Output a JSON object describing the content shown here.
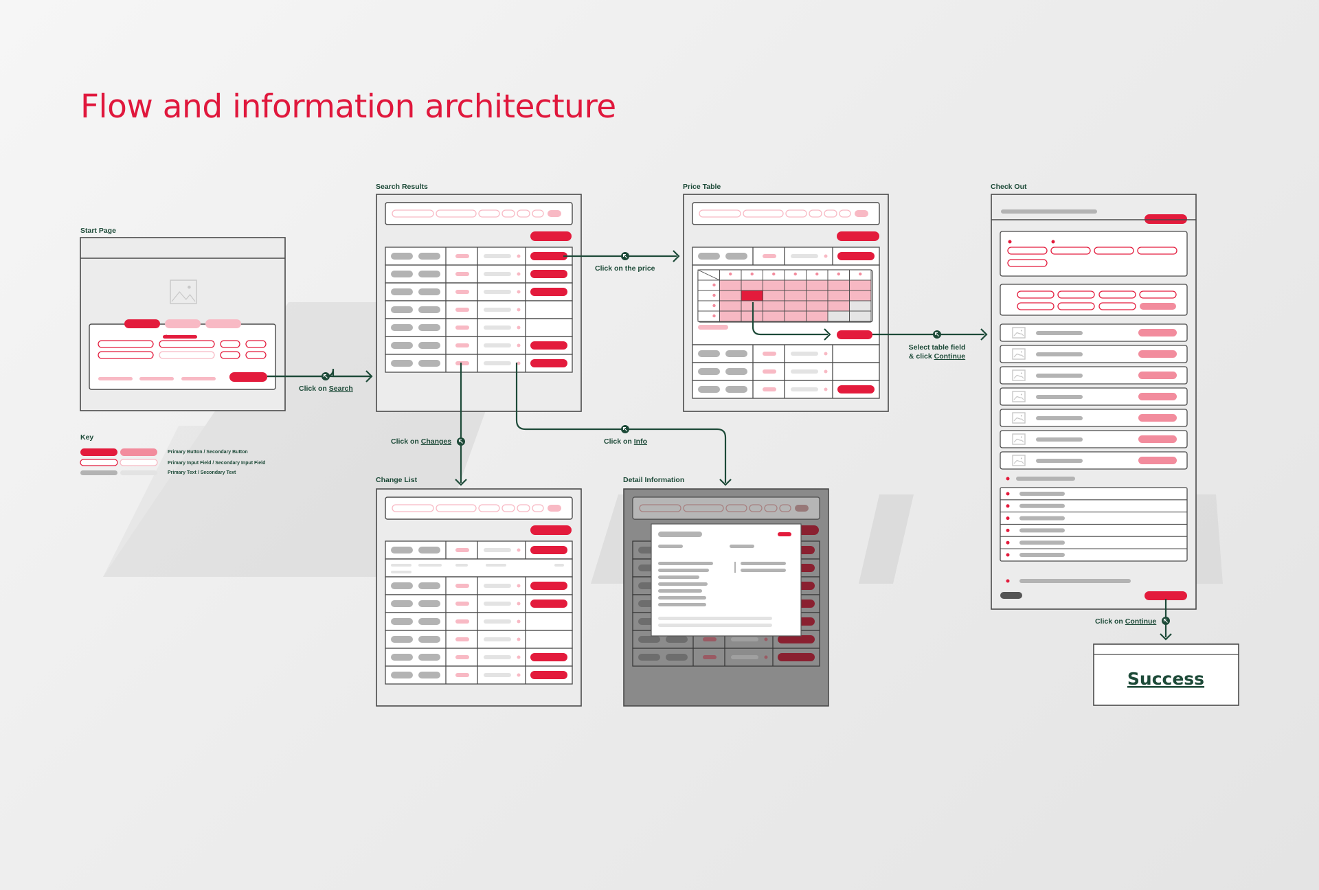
{
  "page": {
    "title": "Flow and information architecture"
  },
  "screens": {
    "start": "Start Page",
    "search": "Search Results",
    "price": "Price Table",
    "checkout": "Check Out",
    "change": "Change List",
    "detail": "Detail Information"
  },
  "flows": {
    "search": {
      "pre": "Click on ",
      "link": "Search"
    },
    "price": {
      "text": "Click on the price"
    },
    "select": {
      "line1": "Select table field",
      "pre2": "& click ",
      "link2": "Continue"
    },
    "changes": {
      "pre": "Click on ",
      "link": "Changes"
    },
    "info": {
      "pre": "Click on ",
      "link": "Info"
    },
    "continue": {
      "pre": "Click on ",
      "link": "Continue"
    }
  },
  "key": {
    "title": "Key",
    "buttons": "Primary Button / Secondary Button",
    "inputs": "Primary Input Field / Secondary Input Field",
    "text": "Primary Text / Secondary Text"
  },
  "success": "Success",
  "colors": {
    "accent": "#e31b3c",
    "secondary": "#f28c9d",
    "light": "#f8b9c4",
    "flow": "#1d4a38",
    "frame": "#4a4a4a",
    "text_primary": "#b3b3b3",
    "text_secondary": "#e3e3e3"
  }
}
